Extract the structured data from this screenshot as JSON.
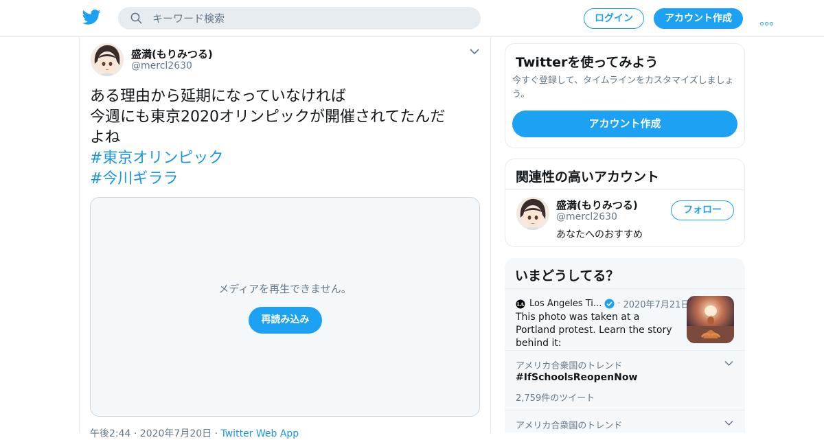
{
  "header": {
    "search_placeholder": "キーワード検索",
    "login_label": "ログイン",
    "signup_label": "アカウント作成"
  },
  "tweet": {
    "display_name": "盛満(もりみつる)",
    "handle": "@mercl2630",
    "lines": [
      "ある理由から延期になっていなければ",
      "今週にも東京2020オリンピックが開催されてたんだ",
      "よね"
    ],
    "hashtags": [
      "#東京オリンピック",
      "#今川ギララ"
    ],
    "media_message": "メディアを再生できません。",
    "media_reload": "再読み込み",
    "time": "午後2:44 · 2020年7月20日 · ",
    "source": "Twitter Web App"
  },
  "signup_card": {
    "title": "Twitterを使ってみよう",
    "description": "今すぐ登録して、タイムラインをカスタマイズしましょう。",
    "button": "アカウント作成"
  },
  "related": {
    "title": "関連性の高いアカウント",
    "name": "盛満(もりみつる)",
    "handle": "@mercl2630",
    "reason": "あなたへのおすすめ",
    "follow": "フォロー"
  },
  "trends": {
    "title": "いまどうしてる？",
    "news": {
      "source": "Los Angeles Ti...",
      "date": "2020年7月21日",
      "text": "This photo was taken at a Portland protest. Learn the story behind it:"
    },
    "items": [
      {
        "context": "アメリカ合衆国のトレンド",
        "name": "#IfSchoolsReopenNow",
        "count": "2,759件のツイート"
      },
      {
        "context": "アメリカ合衆国のトレンド"
      }
    ]
  },
  "colors": {
    "accent": "#1da1f2",
    "link": "#1b95e0",
    "secondary_text": "#657786",
    "border": "#e6ecf0"
  }
}
